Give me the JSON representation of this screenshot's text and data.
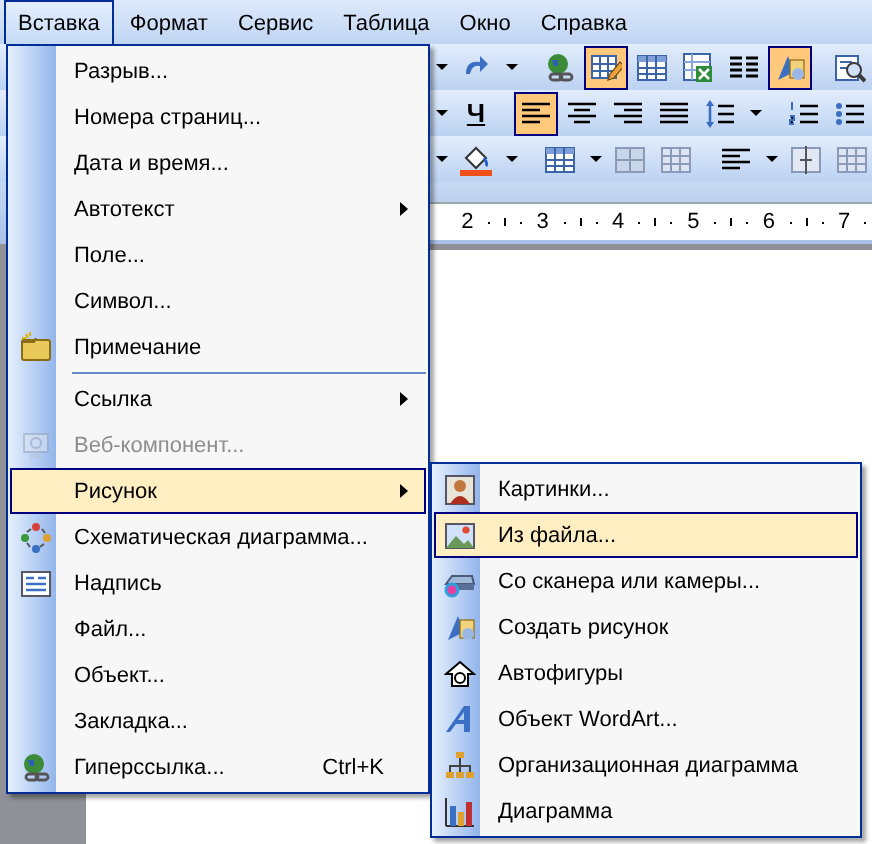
{
  "menu_bar": [
    {
      "label": "Вставка",
      "selected": true
    },
    {
      "label": "Формат",
      "selected": false
    },
    {
      "label": "Сервис",
      "selected": false
    },
    {
      "label": "Таблица",
      "selected": false
    },
    {
      "label": "Окно",
      "selected": false
    },
    {
      "label": "Справка",
      "selected": false
    }
  ],
  "toolbars": [
    {
      "buttons": [
        {
          "kind": "arrow",
          "on": false
        },
        {
          "kind": "redo",
          "on": false
        },
        {
          "kind": "arrow",
          "on": false
        },
        {
          "kind": "separator"
        },
        {
          "kind": "globe",
          "on": false
        },
        {
          "kind": "table-pencil",
          "on": true
        },
        {
          "kind": "table",
          "on": false
        },
        {
          "kind": "sheet",
          "on": false
        },
        {
          "kind": "columns",
          "on": false
        },
        {
          "kind": "shapes",
          "on": true
        },
        {
          "kind": "separator"
        },
        {
          "kind": "magnifier",
          "on": false
        }
      ]
    },
    {
      "buttons": [
        {
          "kind": "arrow",
          "on": false
        },
        {
          "kind": "text",
          "label": "Ч",
          "on": false
        },
        {
          "kind": "separator"
        },
        {
          "kind": "align-left",
          "on": true
        },
        {
          "kind": "align-center",
          "on": false
        },
        {
          "kind": "align-right",
          "on": false
        },
        {
          "kind": "justify",
          "on": false
        },
        {
          "kind": "line-spacing",
          "on": false
        },
        {
          "kind": "arrow",
          "on": false
        },
        {
          "kind": "separator"
        },
        {
          "kind": "numbered-list",
          "on": false
        },
        {
          "kind": "bullet-list",
          "on": false
        }
      ]
    },
    {
      "buttons": [
        {
          "kind": "arrow",
          "on": false
        },
        {
          "kind": "bucket",
          "on": false
        },
        {
          "kind": "arrow",
          "on": false
        },
        {
          "kind": "separator"
        },
        {
          "kind": "table",
          "on": false
        },
        {
          "kind": "arrow",
          "on": false
        },
        {
          "kind": "shade-cells",
          "on": false
        },
        {
          "kind": "grid-cells",
          "on": false
        },
        {
          "kind": "separator"
        },
        {
          "kind": "align-left",
          "on": false
        },
        {
          "kind": "arrow",
          "on": false
        },
        {
          "kind": "distribute",
          "on": false
        },
        {
          "kind": "grid-cells",
          "on": false
        }
      ]
    }
  ],
  "ruler": {
    "marks": [
      "2",
      "3",
      "4",
      "5",
      "6",
      "7"
    ]
  },
  "insert_menu": {
    "items": [
      {
        "kind": "item",
        "label": "Разрыв...",
        "disabled": false,
        "selected": false,
        "submenu": false
      },
      {
        "kind": "item",
        "label": "Номера страниц...",
        "disabled": false,
        "selected": false,
        "submenu": false
      },
      {
        "kind": "item",
        "label": "Дата и время...",
        "disabled": false,
        "selected": false,
        "submenu": false
      },
      {
        "kind": "item",
        "label": "Автотекст",
        "disabled": false,
        "selected": false,
        "submenu": true
      },
      {
        "kind": "item",
        "label": "Поле...",
        "disabled": false,
        "selected": false,
        "submenu": false
      },
      {
        "kind": "item",
        "label": "Символ...",
        "disabled": false,
        "selected": false,
        "submenu": false
      },
      {
        "kind": "item",
        "label": "Примечание",
        "disabled": false,
        "selected": false,
        "submenu": false
      },
      {
        "kind": "separator"
      },
      {
        "kind": "item",
        "label": "Ссылка",
        "disabled": false,
        "selected": false,
        "submenu": true
      },
      {
        "kind": "item",
        "label": "Веб-компонент...",
        "disabled": true,
        "selected": false,
        "submenu": false
      },
      {
        "kind": "item",
        "label": "Рисунок",
        "disabled": false,
        "selected": true,
        "submenu": true
      },
      {
        "kind": "item",
        "label": "Схематическая диаграмма...",
        "disabled": false,
        "selected": false,
        "submenu": false
      },
      {
        "kind": "item",
        "label": "Надпись",
        "disabled": false,
        "selected": false,
        "submenu": false
      },
      {
        "kind": "item",
        "label": "Файл...",
        "disabled": false,
        "selected": false,
        "submenu": false
      },
      {
        "kind": "item",
        "label": "Объект...",
        "disabled": false,
        "selected": false,
        "submenu": false
      },
      {
        "kind": "item",
        "label": "Закладка...",
        "disabled": false,
        "selected": false,
        "submenu": false
      },
      {
        "kind": "item",
        "label": "Гиперссылка...",
        "disabled": false,
        "selected": false,
        "submenu": false,
        "shortcut": "Ctrl+K"
      }
    ]
  },
  "picture_submenu": {
    "items": [
      {
        "kind": "item",
        "label": "Картинки...",
        "disabled": false,
        "selected": false,
        "submenu": false
      },
      {
        "kind": "item",
        "label": "Из файла...",
        "disabled": false,
        "selected": true,
        "submenu": false
      },
      {
        "kind": "item",
        "label": "Со сканера или камеры...",
        "disabled": false,
        "selected": false,
        "submenu": false
      },
      {
        "kind": "item",
        "label": "Создать рисунок",
        "disabled": false,
        "selected": false,
        "submenu": false
      },
      {
        "kind": "item",
        "label": "Автофигуры",
        "disabled": false,
        "selected": false,
        "submenu": false
      },
      {
        "kind": "item",
        "label": "Объект WordArt...",
        "disabled": false,
        "selected": false,
        "submenu": false
      },
      {
        "kind": "item",
        "label": "Организационная диаграмма",
        "disabled": false,
        "selected": false,
        "submenu": false
      },
      {
        "kind": "item",
        "label": "Диаграмма",
        "disabled": false,
        "selected": false,
        "submenu": false
      }
    ]
  }
}
